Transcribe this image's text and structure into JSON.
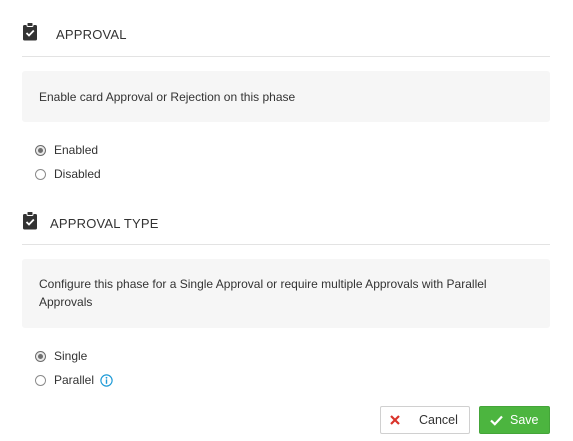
{
  "approval_section": {
    "title": "APPROVAL",
    "icon": "clipboard-check-icon",
    "description": "Enable card Approval or Rejection on this phase",
    "options": [
      {
        "label": "Enabled",
        "selected": true
      },
      {
        "label": "Disabled",
        "selected": false
      }
    ]
  },
  "approval_type_section": {
    "title": "APPROVAL TYPE",
    "icon": "clipboard-check-icon",
    "description": "Configure this phase for a Single Approval or require multiple Approvals with Parallel Approvals",
    "options": [
      {
        "label": "Single",
        "selected": true
      },
      {
        "label": "Parallel",
        "selected": false,
        "info_icon": "info-circle-icon"
      }
    ]
  },
  "actions": {
    "cancel_label": "Cancel",
    "save_label": "Save"
  },
  "colors": {
    "save_green": "#4cb53f",
    "cancel_x_red": "#d9342b",
    "info_blue": "#1f9bd7",
    "panel_bg": "#f6f6f6"
  }
}
